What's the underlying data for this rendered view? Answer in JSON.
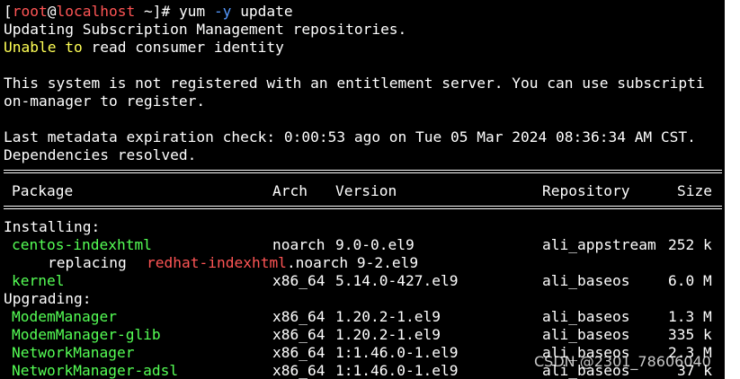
{
  "colors": {
    "background": "#000000",
    "text": "#ffffff",
    "user": "#ff5555",
    "host": "#ff5555",
    "option": "#5599ff",
    "warning": "#ffff55",
    "package": "#55ff55",
    "replaced": "#ff5555"
  },
  "prompt": {
    "open": "[",
    "user": "root",
    "at": "@",
    "host": "localhost",
    "path": " ~]# ",
    "cmd": "yum",
    "option": "-y",
    "arg": "update"
  },
  "messages": {
    "updating_repos": "Updating Subscription Management repositories.",
    "unable_word": "Unable",
    "to_word": "to",
    "unable_rest": "read consumer identity",
    "not_registered_1": "This system is not registered with an entitlement server. You can use subscripti",
    "not_registered_2": "on-manager to register.",
    "metadata": "Last metadata expiration check: 0:00:53 ago on Tue 05 Mar 2024 08:36:34 AM CST.",
    "resolved": "Dependencies resolved."
  },
  "table": {
    "headers": {
      "package": "Package",
      "arch": "Arch",
      "version": "Version",
      "repository": "Repository",
      "size": "Size"
    },
    "installing_label": "Installing:",
    "upgrading_label": "Upgrading:",
    "installing": [
      {
        "name": "centos-indexhtml",
        "arch": "noarch",
        "version": "9.0-0.el9",
        "repo": "ali_appstream",
        "size": "252 k"
      },
      {
        "name": "kernel",
        "arch": "x86_64",
        "version": "5.14.0-427.el9",
        "repo": "ali_baseos",
        "size": "6.0 M"
      }
    ],
    "replacing": {
      "word": "replacing",
      "name": "redhat-indexhtml",
      "rest": ".noarch 9-2.el9"
    },
    "upgrading": [
      {
        "name": "ModemManager",
        "arch": "x86_64",
        "version": "1.20.2-1.el9",
        "repo": "ali_baseos",
        "size": "1.3 M"
      },
      {
        "name": "ModemManager-glib",
        "arch": "x86_64",
        "version": "1.20.2-1.el9",
        "repo": "ali_baseos",
        "size": "335 k"
      },
      {
        "name": "NetworkManager",
        "arch": "x86_64",
        "version": "1:1.46.0-1.el9",
        "repo": "ali_baseos",
        "size": "2.3 M"
      },
      {
        "name": "NetworkManager-adsl",
        "arch": "x86_64",
        "version": "1:1.46.0-1.el9",
        "repo": "ali_baseos",
        "size": "37 k"
      }
    ]
  },
  "watermark": "CSDN @2301_78606040"
}
